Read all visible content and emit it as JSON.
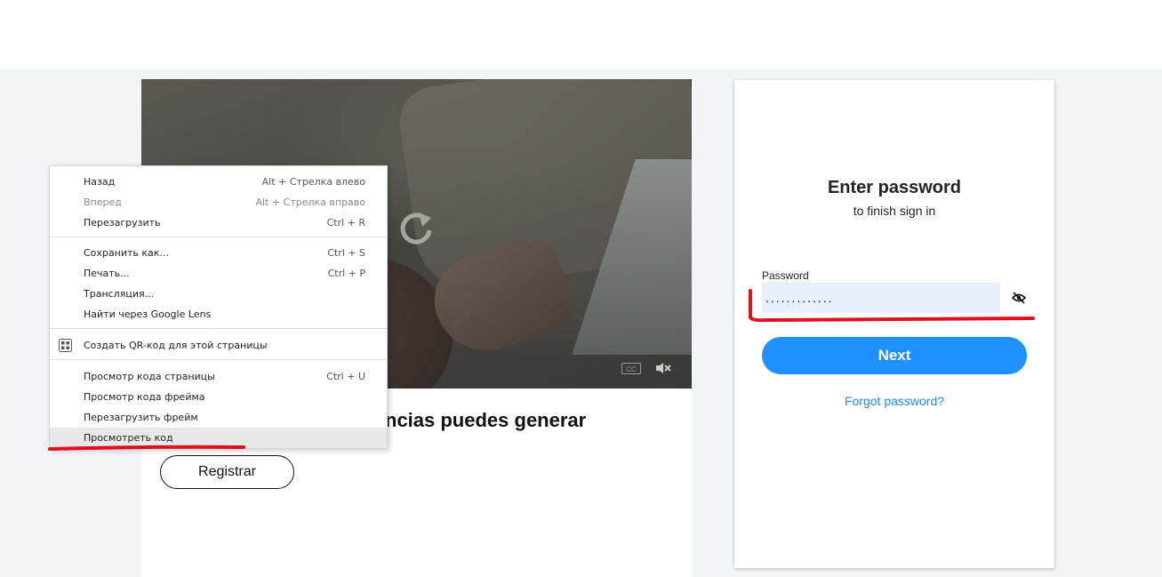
{
  "promo": {
    "heading": "ncias puedes generar",
    "register_label": "Registrar",
    "cc_label": "CC"
  },
  "signin": {
    "title": "Enter password",
    "subtitle": "to finish sign in",
    "password_label": "Password",
    "password_value": ".............",
    "next_label": "Next",
    "forgot_label": "Forgot password?"
  },
  "context_menu": {
    "items": [
      {
        "label": "Назад",
        "shortcut": "Alt + Стрелка влево"
      },
      {
        "label": "Вперед",
        "shortcut": "Alt + Стрелка вправо"
      },
      {
        "label": "Перезагрузить",
        "shortcut": "Ctrl + R"
      },
      {
        "label": "Сохранить как...",
        "shortcut": "Ctrl + S"
      },
      {
        "label": "Печать...",
        "shortcut": "Ctrl + P"
      },
      {
        "label": "Трансляция...",
        "shortcut": ""
      },
      {
        "label": "Найти через Google Lens",
        "shortcut": ""
      },
      {
        "label": "Создать QR-код для этой страницы",
        "shortcut": ""
      },
      {
        "label": "Просмотр кода страницы",
        "shortcut": "Ctrl + U"
      },
      {
        "label": "Просмотр кода фрейма",
        "shortcut": ""
      },
      {
        "label": "Перезагрузить фрейм",
        "shortcut": ""
      },
      {
        "label": "Просмотреть код",
        "shortcut": ""
      }
    ]
  },
  "colors": {
    "accent": "#1e90ff",
    "link": "#1a8cef",
    "annotation": "#e0101e",
    "page_bg": "#f2f5f8"
  },
  "icons": [
    "replay-icon",
    "cc-icon",
    "mute-icon",
    "eye-off-icon",
    "qr-code-icon"
  ]
}
